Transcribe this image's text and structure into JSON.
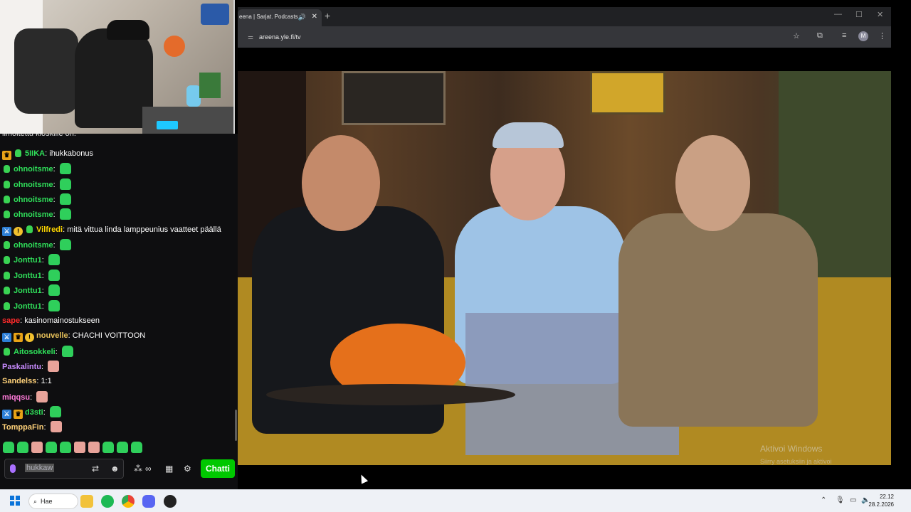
{
  "browser": {
    "tab_title": "eena | Sarjat. Podcasts",
    "url": "areena.yle.fi/tv",
    "new_tab_symbol": "+",
    "avatar_letter": "M"
  },
  "video": {
    "watermark_title": "Aktivoi Windows",
    "watermark_subtitle": "Siirry asetuksiin ja aktivoi"
  },
  "chat": {
    "partial_top": "ilmoitettu kioskille on.",
    "messages": [
      {
        "badges": [
          "crown",
          "green"
        ],
        "name": "5IIKA",
        "color": "#2fe05a",
        "text": "ihukkabonus",
        "emotes": []
      },
      {
        "badges": [
          "green"
        ],
        "name": "ohnoitsme",
        "color": "#2fe05a",
        "text": "",
        "emotes": [
          "green"
        ]
      },
      {
        "badges": [
          "green"
        ],
        "name": "ohnoitsme",
        "color": "#2fe05a",
        "text": "",
        "emotes": [
          "green"
        ]
      },
      {
        "badges": [
          "green"
        ],
        "name": "ohnoitsme",
        "color": "#2fe05a",
        "text": "",
        "emotes": [
          "green"
        ]
      },
      {
        "badges": [
          "green"
        ],
        "name": "ohnoitsme",
        "color": "#2fe05a",
        "text": "",
        "emotes": [
          "green"
        ]
      },
      {
        "badges": [
          "sword",
          "coin",
          "green"
        ],
        "name": "Vilfredi",
        "color": "#ffd700",
        "text": "mitä vittua linda lamppeunius vaatteet päällä",
        "emotes": []
      },
      {
        "badges": [
          "green"
        ],
        "name": "ohnoitsme",
        "color": "#2fe05a",
        "text": "",
        "emotes": [
          "green"
        ]
      },
      {
        "badges": [
          "green"
        ],
        "name": "Jonttu1",
        "color": "#2fe05a",
        "text": "",
        "emotes": [
          "green"
        ]
      },
      {
        "badges": [
          "green"
        ],
        "name": "Jonttu1",
        "color": "#2fe05a",
        "text": "",
        "emotes": [
          "green"
        ]
      },
      {
        "badges": [
          "green"
        ],
        "name": "Jonttu1",
        "color": "#2fe05a",
        "text": "",
        "emotes": [
          "green"
        ]
      },
      {
        "badges": [
          "green"
        ],
        "name": "Jonttu1",
        "color": "#2fe05a",
        "text": "",
        "emotes": [
          "green"
        ]
      },
      {
        "badges": [],
        "name": "sape",
        "color": "#ff2b2b",
        "text": "kasinomainostukseen",
        "emotes": []
      },
      {
        "badges": [
          "sword",
          "crown",
          "coin"
        ],
        "name": "nouvelle",
        "color": "#e8c25a",
        "text": "CHACHI VOITTOON",
        "emotes": []
      },
      {
        "badges": [
          "green"
        ],
        "name": "Aitosokkeli",
        "color": "#2fe05a",
        "text": "",
        "emotes": [
          "green"
        ]
      },
      {
        "badges": [],
        "name": "Paskalintu",
        "color": "#c88bff",
        "text": "",
        "emotes": [
          "face"
        ]
      },
      {
        "badges": [],
        "name": "Sandelss",
        "color": "#ffd27a",
        "text": "1:1",
        "emotes": []
      },
      {
        "badges": [],
        "name": "miqqsu",
        "color": "#ff7ad9",
        "text": "",
        "emotes": [
          "face"
        ]
      },
      {
        "badges": [
          "sword",
          "crown"
        ],
        "name": "d3sti",
        "color": "#2fe05a",
        "text": "",
        "emotes": [
          "green"
        ]
      },
      {
        "badges": [],
        "name": "TomppaFin",
        "color": "#ffd27a",
        "text": "",
        "emotes": [
          "face"
        ]
      }
    ],
    "input_placeholder": "hukkaw",
    "send_label": "Chatti"
  },
  "taskbar": {
    "search_label": "Hae",
    "time": "22.12",
    "date": "28.2.2026"
  }
}
